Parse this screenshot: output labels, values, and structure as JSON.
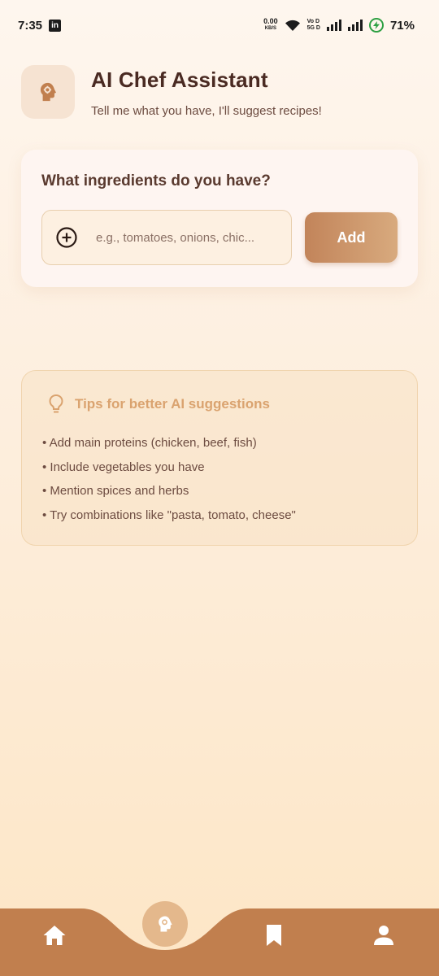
{
  "status_bar": {
    "time": "7:35",
    "app_icon": "linkedin-icon",
    "net_speed_value": "0.00",
    "net_speed_unit": "KB/S",
    "network_label_top": "Vo D",
    "network_label_bottom": "5G D",
    "battery": "71%"
  },
  "header": {
    "icon": "chef-brain-icon",
    "title": "AI Chef Assistant",
    "subtitle": "Tell me what you have, I'll suggest recipes!"
  },
  "ingredients_card": {
    "title": "What ingredients do you have?",
    "input_placeholder": "e.g., tomatoes, onions, chic...",
    "input_value": "",
    "add_label": "Add"
  },
  "tips": {
    "title": "Tips for better AI suggestions",
    "items": [
      "• Add main proteins (chicken, beef, fish)",
      "• Include vegetables you have",
      "• Mention spices and herbs",
      "• Try combinations like \"pasta, tomato, cheese\""
    ]
  },
  "bottom_nav": {
    "items": [
      "home-icon",
      "chef-brain-icon",
      "bookmark-icon",
      "profile-icon"
    ],
    "active": "chef-brain-icon"
  },
  "colors": {
    "accent": "#c17f4e",
    "title_text": "#4a2a22",
    "tips_title": "#daa36f",
    "background_top": "#fef6ee",
    "background_bottom": "#fde6c6"
  }
}
